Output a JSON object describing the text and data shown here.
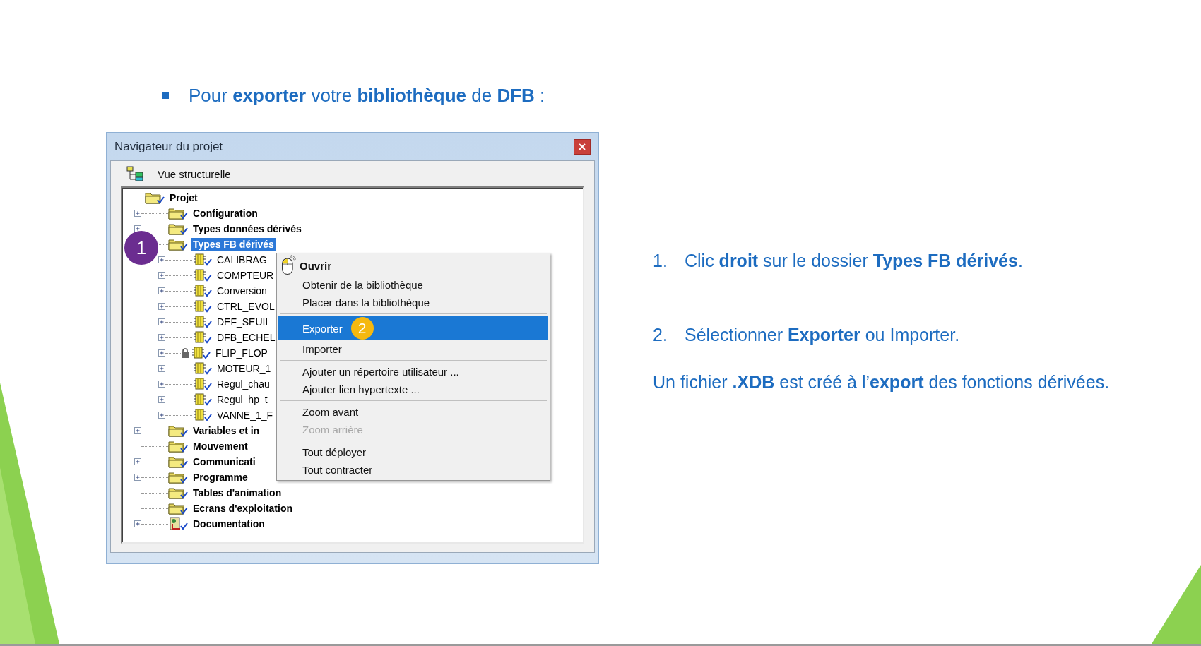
{
  "heading": "Pour **exporter** votre **bibliothèque** de **DFB** :",
  "window": {
    "title": "Navigateur du projet",
    "toolbar_label": "Vue structurelle",
    "tree": {
      "label": "Projet",
      "kind": "folder",
      "selected": false,
      "children": [
        {
          "label": "Configuration",
          "kind": "folder",
          "expandable": true,
          "selected": false
        },
        {
          "label": "Types données dérivés",
          "kind": "folder",
          "expandable": true,
          "selected": false
        },
        {
          "label": "Types FB dérivés",
          "kind": "folder",
          "expandable": false,
          "selected": true,
          "badge": {
            "text": "1",
            "color": "#6b2d90"
          },
          "children": [
            {
              "label": "CALIBRAG",
              "kind": "fb",
              "expandable": true,
              "selected": false,
              "locked": false
            },
            {
              "label": "COMPTEUR",
              "kind": "fb",
              "expandable": true,
              "selected": false,
              "locked": false
            },
            {
              "label": "Conversion",
              "kind": "fb",
              "expandable": true,
              "selected": false,
              "locked": false
            },
            {
              "label": "CTRL_EVOL",
              "kind": "fb",
              "expandable": true,
              "selected": false,
              "locked": false
            },
            {
              "label": "DEF_SEUIL",
              "kind": "fb",
              "expandable": true,
              "selected": false,
              "locked": false
            },
            {
              "label": "DFB_ECHEL",
              "kind": "fb",
              "expandable": true,
              "selected": false,
              "locked": false
            },
            {
              "label": "FLIP_FLOP",
              "kind": "fb",
              "expandable": true,
              "selected": false,
              "locked": true
            },
            {
              "label": "MOTEUR_1",
              "kind": "fb",
              "expandable": true,
              "selected": false,
              "locked": false
            },
            {
              "label": "Regul_chau",
              "kind": "fb",
              "expandable": true,
              "selected": false,
              "locked": false
            },
            {
              "label": "Regul_hp_t",
              "kind": "fb",
              "expandable": true,
              "selected": false,
              "locked": false
            },
            {
              "label": "VANNE_1_F",
              "kind": "fb",
              "expandable": true,
              "selected": false,
              "locked": false
            }
          ]
        },
        {
          "label": "Variables et in",
          "kind": "folder",
          "expandable": true,
          "selected": false
        },
        {
          "label": "Mouvement",
          "kind": "folder",
          "expandable": false,
          "selected": false
        },
        {
          "label": "Communicati",
          "kind": "folder",
          "expandable": true,
          "selected": false
        },
        {
          "label": "Programme",
          "kind": "folder",
          "expandable": true,
          "selected": false
        },
        {
          "label": "Tables d'animation",
          "kind": "folder",
          "expandable": false,
          "selected": false
        },
        {
          "label": "Ecrans d'exploitation",
          "kind": "folder",
          "expandable": false,
          "selected": false
        },
        {
          "label": "Documentation",
          "kind": "doc",
          "expandable": true,
          "selected": false
        }
      ]
    },
    "context_menu": [
      {
        "kind": "item",
        "label": "Ouvrir",
        "bold": true,
        "selected": false,
        "disabled": false,
        "pointer": true
      },
      {
        "kind": "item",
        "label": "Obtenir de la bibliothèque",
        "bold": false,
        "selected": false,
        "disabled": false
      },
      {
        "kind": "item",
        "label": "Placer dans la bibliothèque",
        "bold": false,
        "selected": false,
        "disabled": false
      },
      {
        "kind": "separator"
      },
      {
        "kind": "item",
        "label": "Exporter",
        "bold": false,
        "selected": true,
        "disabled": false,
        "badge": {
          "text": "2",
          "color": "#f5b80f"
        }
      },
      {
        "kind": "item",
        "label": "Importer",
        "bold": false,
        "selected": false,
        "disabled": false
      },
      {
        "kind": "separator"
      },
      {
        "kind": "item",
        "label": "Ajouter un répertoire utilisateur ...",
        "bold": false,
        "selected": false,
        "disabled": false
      },
      {
        "kind": "item",
        "label": "Ajouter lien hypertexte ...",
        "bold": false,
        "selected": false,
        "disabled": false
      },
      {
        "kind": "separator"
      },
      {
        "kind": "item",
        "label": "Zoom avant",
        "bold": false,
        "selected": false,
        "disabled": false
      },
      {
        "kind": "item",
        "label": "Zoom arrière",
        "bold": false,
        "selected": false,
        "disabled": true
      },
      {
        "kind": "separator"
      },
      {
        "kind": "item",
        "label": "Tout déployer",
        "bold": false,
        "selected": false,
        "disabled": false
      },
      {
        "kind": "item",
        "label": "Tout contracter",
        "bold": false,
        "selected": false,
        "disabled": false
      }
    ]
  },
  "steps": [
    {
      "number": "1.",
      "text": "Clic **droit** sur le dossier **Types FB dérivés**."
    },
    {
      "number": "2.",
      "text": "Sélectionner **Exporter** ou Importer."
    }
  ],
  "note": "Un fichier **.XDB** est créé à l’**export** des fonctions dérivées."
}
